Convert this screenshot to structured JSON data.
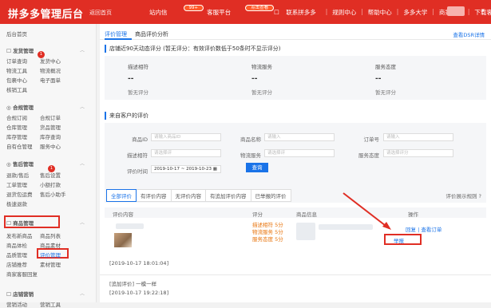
{
  "brand": {
    "logo": "拼多多管理后台",
    "back": "返回首页"
  },
  "topnav": {
    "items": [
      "站内信",
      "客服平台",
      "联系拼多多",
      "规则中心",
      "帮助中心",
      "多多大学",
      "商家社区",
      "下载客户端"
    ],
    "badge1": "99+",
    "badge2": "点击查看"
  },
  "sidebar": {
    "home": "后台首页",
    "ship": {
      "title": "发货管理",
      "items": [
        "订单查询",
        "发货中心",
        "物流工具",
        "物流概况",
        "包裹中心",
        "电子面单",
        "核销工具"
      ]
    },
    "contract": {
      "title": "合规管理",
      "items": [
        "合规订阅",
        "合规订单",
        "仓库管理",
        "货品管理",
        "库存管理",
        "库存查询",
        "自有仓管理",
        "服务中心"
      ]
    },
    "after": {
      "title": "售后管理",
      "items": [
        "退款/售后",
        "售后设置",
        "工单管理",
        "小额打款",
        "退货包运费",
        "售后小助手",
        "极速退款"
      ]
    },
    "goods": {
      "title": "商品管理",
      "items": [
        "发布新商品",
        "商品列表",
        "商品体检",
        "商品素材",
        "品质管理",
        "评价管理",
        "店铺推荐",
        "素材管理",
        "商家客服回复"
      ]
    },
    "shop": {
      "title": "店铺营销",
      "items": [
        "营销活动",
        "营销工具"
      ]
    }
  },
  "main": {
    "tabs": [
      "评价管理",
      "商品评价分析"
    ],
    "dsr_link": "查看DSR详情",
    "score_title": "店铺近90天动态评分 (暂无评分：有效评价数低于50条时不显示评分)",
    "scores": [
      {
        "name": "描述相符",
        "value": "--",
        "note": "暂无评分"
      },
      {
        "name": "物流服务",
        "value": "--",
        "note": "暂无评分"
      },
      {
        "name": "服务态度",
        "value": "--",
        "note": "暂无评分"
      }
    ],
    "from_title": "来自客户的评价",
    "form": {
      "goods_id": {
        "label": "商品ID",
        "placeholder": "请输入商品ID"
      },
      "goods_name": {
        "label": "商品名称",
        "placeholder": "请输入"
      },
      "order_no": {
        "label": "订单号",
        "placeholder": "请输入"
      },
      "desc": {
        "label": "描述相符",
        "placeholder": "请选择评"
      },
      "logi": {
        "label": "物流服务",
        "placeholder": "请选择评"
      },
      "serv": {
        "label": "服务态度",
        "placeholder": "请选择评分"
      },
      "time": {
        "label": "评价时间",
        "value": "2019-10-17 ~ 2019-10-23"
      },
      "query": "查询"
    },
    "filters": [
      "全部评价",
      "有评价内容",
      "无评价内容",
      "有追加评价内容",
      "已举报的评价"
    ],
    "rule": "评价展示规则",
    "table": {
      "headers": [
        "评价内容",
        "评分",
        "商品信息",
        "操作"
      ]
    },
    "row": {
      "desc": "描述相符 5分",
      "logi": "物流服务 5分",
      "serv": "服务态度 5分",
      "time": "[2019-10-17 18:01:04]",
      "reply": "回复",
      "view_order": "查看订单",
      "report": "举报",
      "append": "[追加评价] 一模一样",
      "append_time": "[2019-10-17 19:22:18]"
    }
  }
}
